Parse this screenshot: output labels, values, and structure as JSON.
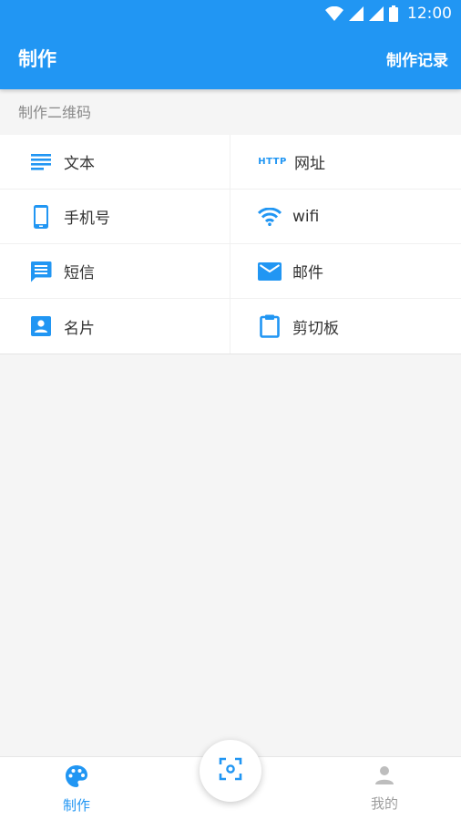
{
  "status_bar": {
    "time": "12:00"
  },
  "app_bar": {
    "title": "制作",
    "action_label": "制作记录"
  },
  "section": {
    "label": "制作二维码"
  },
  "items": [
    {
      "label": "文本",
      "icon": "text-lines-icon"
    },
    {
      "label": "网址",
      "icon": "http-icon",
      "icon_text": "HTTP"
    },
    {
      "label": "手机号",
      "icon": "phone-icon"
    },
    {
      "label": "wifi",
      "icon": "wifi-icon"
    },
    {
      "label": "短信",
      "icon": "sms-icon"
    },
    {
      "label": "邮件",
      "icon": "mail-icon"
    },
    {
      "label": "名片",
      "icon": "contact-card-icon"
    },
    {
      "label": "剪切板",
      "icon": "clipboard-icon"
    }
  ],
  "bottom_nav": {
    "make_label": "制作",
    "mine_label": "我的"
  },
  "colors": {
    "primary": "#2196F3",
    "inactive": "#9e9e9e"
  }
}
